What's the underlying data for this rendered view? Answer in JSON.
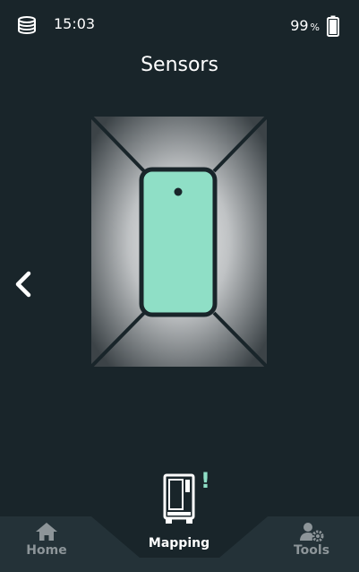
{
  "status_bar": {
    "time": "15:03",
    "battery_value": "99",
    "battery_unit": "%",
    "logo_icon": "stacked-discs-icon",
    "battery_icon": "battery-icon"
  },
  "header": {
    "title": "Sensors"
  },
  "illustration": {
    "device_color": "#8fdfc6",
    "frame_color": "#19252a"
  },
  "navigation": {
    "back_icon": "chevron-left-icon",
    "items": [
      {
        "label": "Home",
        "icon": "home-icon"
      },
      {
        "label": "Mapping",
        "icon": "vending-machine-icon",
        "alert": "!"
      },
      {
        "label": "Tools",
        "icon": "user-gear-icon"
      }
    ]
  },
  "colors": {
    "background": "#19252a",
    "nav_background": "#243238",
    "accent": "#8fdfc6",
    "inactive": "#8d9599"
  }
}
